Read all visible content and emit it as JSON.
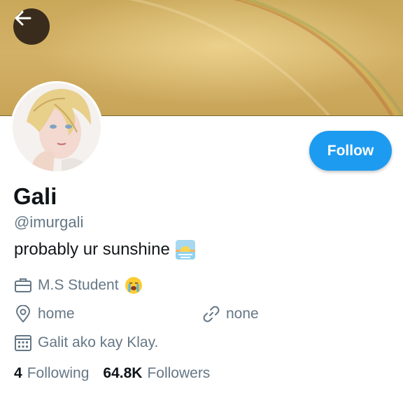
{
  "profile": {
    "name": "Gali",
    "handle": "@imurgali",
    "bio": "probably ur sunshine"
  },
  "follow_button": {
    "label": "Follow"
  },
  "meta": {
    "work": "M.S Student",
    "location": "home",
    "website": "none",
    "joined": "Galit ako kay Klay."
  },
  "counts": {
    "following_count": "4",
    "following_label": "Following",
    "followers_count": "64.8K",
    "followers_label": "Followers"
  },
  "icons": {
    "back": "arrow-left-icon",
    "work": "briefcase-icon",
    "location": "location-pin-icon",
    "website": "link-icon",
    "joined": "calendar-icon",
    "bio_emoji": "sunrise-emoji",
    "work_emoji": "crying-face-emoji"
  },
  "colors": {
    "accent": "#1d9bf0",
    "secondary_text": "#657786",
    "primary_text": "#0f1419"
  }
}
